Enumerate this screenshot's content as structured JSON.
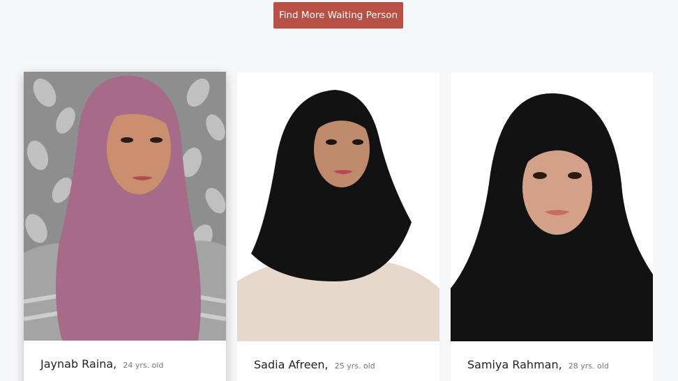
{
  "header": {
    "find_button_label": "Find More Waiting Person"
  },
  "profiles": [
    {
      "name": "Jaynab Raina",
      "age": "24 yrs. old",
      "photo_icon": "profile-photo-jaynab"
    },
    {
      "name": "Sadia Afreen",
      "age": "25 yrs. old",
      "photo_icon": "profile-photo-sadia"
    },
    {
      "name": "Samiya Rahman",
      "age": "28 yrs. old",
      "photo_icon": "profile-photo-samiya"
    }
  ],
  "colors": {
    "page_background": "#f6f7f9",
    "button": "#b75046",
    "hijab_mauve": "#a56b89",
    "hijab_black": "#121212"
  }
}
